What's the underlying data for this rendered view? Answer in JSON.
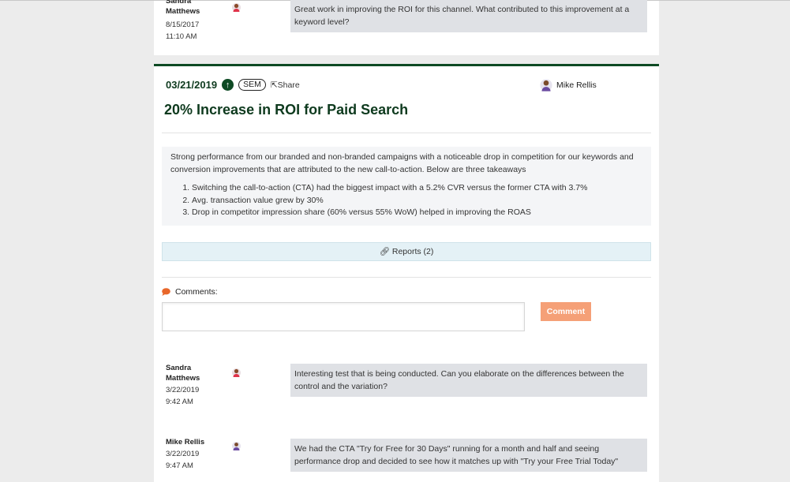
{
  "previous_comment": {
    "name": "Sandra Matthews",
    "date": "8/15/2017",
    "time": "11:10 AM",
    "text": "Great work in improving the ROI for this channel. What contributed to this improvement at a keyword level?"
  },
  "insight": {
    "date": "03/21/2019",
    "tag": "SEM",
    "share_label": "Share",
    "author": "Mike Rellis",
    "title": "20% Increase in ROI for Paid Search",
    "description": "Strong performance from our branded and non-branded campaigns with a noticeable drop in competition for our keywords and conversion improvements that are attributed to the new call-to-action. Below are three takeaways",
    "takeaways": [
      "Switching the call-to-action (CTA) had the biggest impact with a 5.2% CVR versus the former CTA with 3.7%",
      "Avg. transaction value grew by 30%",
      "Drop in competitor impression share (60% versus 55% WoW) helped in improving the ROAS"
    ],
    "reports_label": "Reports (2)",
    "comments_label": "Comments:",
    "comment_input_value": "",
    "comment_button": "Comment",
    "comments": [
      {
        "name": "Sandra Matthews",
        "date": "3/22/2019",
        "time": "9:42 AM",
        "text": "Interesting test that is being conducted. Can you elaborate on the differences between the control and the variation?"
      },
      {
        "name": "Mike Rellis",
        "date": "3/22/2019",
        "time": "9:47 AM",
        "text": "We had the CTA \"Try for Free for 30 Days\" running for a month and half and seeing performance drop and decided to see how it matches up with \"Try your Free Trial Today\""
      }
    ]
  },
  "colors": {
    "brand": "#0e4a24",
    "button": "#f5a077",
    "comment_icon": "#e8672a"
  }
}
